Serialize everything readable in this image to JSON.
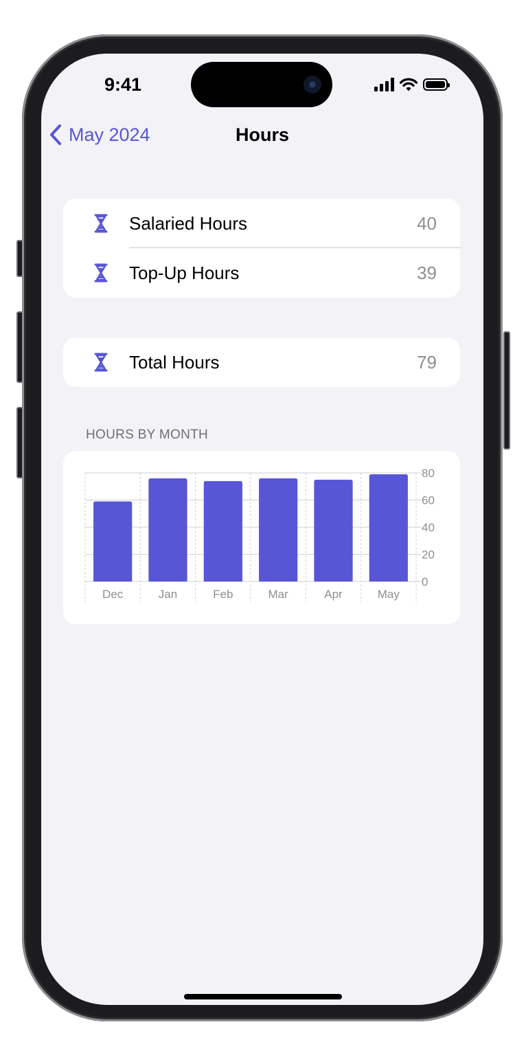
{
  "status_bar": {
    "time": "9:41"
  },
  "nav": {
    "back_label": "May 2024",
    "title": "Hours"
  },
  "hours_list": {
    "items": [
      {
        "label": "Salaried Hours",
        "value": "40"
      },
      {
        "label": "Top-Up Hours",
        "value": "39"
      }
    ]
  },
  "total": {
    "label": "Total Hours",
    "value": "79"
  },
  "chart_section": {
    "header": "HOURS BY MONTH"
  },
  "colors": {
    "accent": "#5856d6",
    "background": "#f2f2f7",
    "card": "#ffffff",
    "secondary_text": "#8e8e93"
  },
  "chart_data": {
    "type": "bar",
    "categories": [
      "Dec",
      "Jan",
      "Feb",
      "Mar",
      "Apr",
      "May"
    ],
    "values": [
      59,
      76,
      74,
      76,
      75,
      79
    ],
    "y_ticks": [
      "0",
      "20",
      "40",
      "60",
      "80"
    ],
    "ylim": [
      0,
      80
    ],
    "y_axis_side": "right",
    "grid": true,
    "bar_color": "#5856d6"
  }
}
